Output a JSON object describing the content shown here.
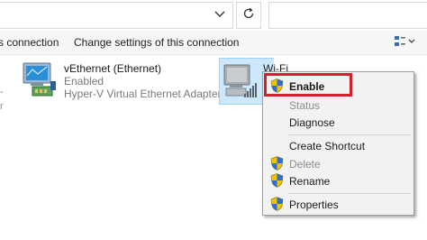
{
  "commandbar": {
    "left_truncated": "s connection",
    "change_settings": "Change settings of this connection"
  },
  "adapters": {
    "vethernet": {
      "name": "vEthernet (Ethernet)",
      "status": "Enabled",
      "device": "Hyper-V Virtual Ethernet Adapter"
    },
    "wifi": {
      "name": "Wi-Fi"
    }
  },
  "left_edge": {
    "line1": "-",
    "line2": "r"
  },
  "context_menu": {
    "items": [
      {
        "label": "Enable",
        "icon": "uac-shield-icon",
        "enabled": true,
        "default": true
      },
      {
        "label": "Status",
        "enabled": false
      },
      {
        "label": "Diagnose",
        "enabled": true
      },
      {
        "label": "Create Shortcut",
        "enabled": true
      },
      {
        "label": "Delete",
        "icon": "uac-shield-icon",
        "enabled": false
      },
      {
        "label": "Rename",
        "icon": "uac-shield-icon",
        "enabled": true
      },
      {
        "label": "Properties",
        "icon": "uac-shield-icon",
        "enabled": true
      }
    ]
  },
  "colors": {
    "selection_bg": "#cce8ff",
    "highlight_border": "#d1202f",
    "menu_bg": "#f2f2f2"
  }
}
